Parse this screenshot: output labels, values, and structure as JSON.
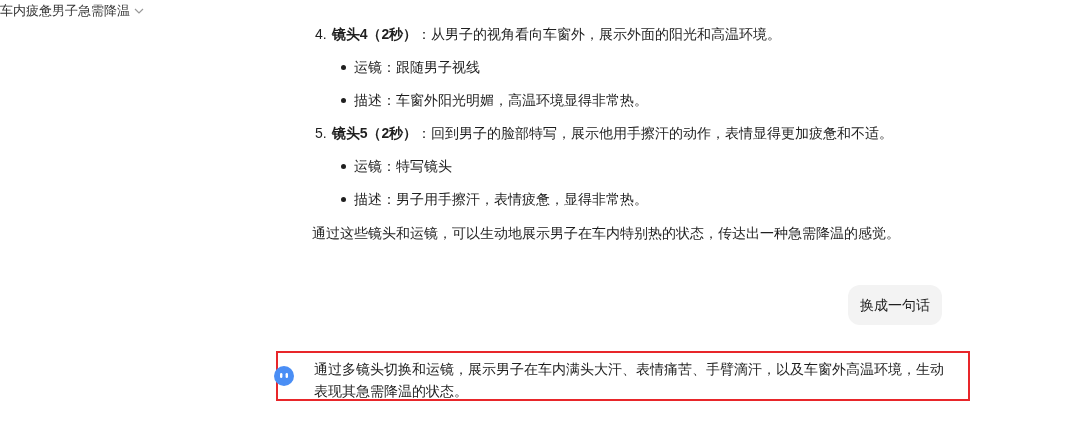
{
  "header": {
    "title": "车内疲惫男子急需降温"
  },
  "steps": [
    {
      "number": "4.",
      "heading": "镜头4（2秒）",
      "text": "：从男子的视角看向车窗外，展示外面的阳光和高温环境。",
      "bullets": [
        "运镜：跟随男子视线",
        "描述：车窗外阳光明媚，高温环境显得非常热。"
      ]
    },
    {
      "number": "5.",
      "heading": "镜头5（2秒）",
      "text": "：回到男子的脸部特写，展示他用手擦汗的动作，表情显得更加疲惫和不适。",
      "bullets": [
        "运镜：特写镜头",
        "描述：男子用手擦汗，表情疲惫，显得非常热。"
      ]
    }
  ],
  "summary": "通过这些镜头和运镜，可以生动地展示男子在车内特别热的状态，传达出一种急需降温的感觉。",
  "user_message": "换成一句话",
  "reply": {
    "text": "通过多镜头切换和运镜，展示男子在车内满头大汗、表情痛苦、手臂滴汗，以及车窗外高温环境，生动表现其急需降温的状态。",
    "highlighted": true
  }
}
